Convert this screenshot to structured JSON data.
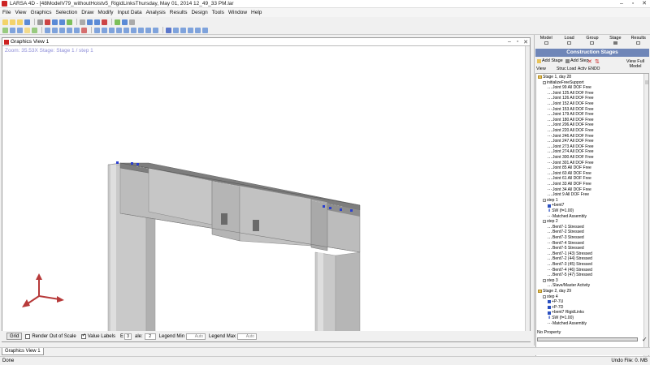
{
  "window": {
    "title": "LARSA 4D - [48ModelV79_withoutHoistv5_RigidLinksThursday, May 01, 2014 12_49_33 PM.lar",
    "minimize": "–",
    "maximize": "▫",
    "close": "✕"
  },
  "menu": [
    "File",
    "View",
    "Graphics",
    "Selection",
    "Draw",
    "Modify",
    "Input Data",
    "Analysis",
    "Results",
    "Design",
    "Tools",
    "Window",
    "Help"
  ],
  "graphics_view": {
    "title": "Graphics View 1",
    "zoom_text": "Zoom: 35.53X    Stage: Stage 1 / step 1",
    "min": "–",
    "restore": "▫",
    "close": "✕"
  },
  "graphics_bar": {
    "grid_button": "Grid",
    "render_out_of_scale": "Render Out of Scale",
    "value_labels": "Value Labels",
    "value_labels_checked": true,
    "scale_label": "E",
    "scale_field": "3",
    "scale_text": "ale:",
    "scale_value": "2",
    "legend_min_label": "Legend Min",
    "legend_min_value": "Auto",
    "legend_max_label": "Legend Max",
    "legend_max_value": "Auto"
  },
  "tab": "Graphics View 1",
  "status": {
    "left": "Done",
    "right": "Undo File: 0. MB"
  },
  "right_panel": {
    "tabs": [
      "Model",
      "Load",
      "Group",
      "Stage",
      "Results"
    ],
    "active_tab": "Stage",
    "header": "Construction Stages",
    "add_stage": "Add Stage",
    "add_step": "Add Step",
    "view": "View",
    "view_full_model": "View Full Model",
    "sub_labels": [
      "Struc",
      "Load",
      "Activ",
      "ENDO"
    ],
    "no_property": "No Property",
    "ok_icon": "✓"
  },
  "tree": [
    {
      "indent": 0,
      "type": "folder",
      "label": "Stage 1, day 28"
    },
    {
      "indent": 1,
      "type": "step",
      "label": "initializeFreeSupport"
    },
    {
      "indent": 2,
      "type": "leaf",
      "label": "Joint 99 All DOF Free"
    },
    {
      "indent": 2,
      "type": "leaf",
      "label": "Joint 125 All DOF Free"
    },
    {
      "indent": 2,
      "type": "leaf",
      "label": "Joint 126 All DOF Free"
    },
    {
      "indent": 2,
      "type": "leaf",
      "label": "Joint 152 All DOF Free"
    },
    {
      "indent": 2,
      "type": "leaf",
      "label": "Joint 153 All DOF Free"
    },
    {
      "indent": 2,
      "type": "leaf",
      "label": "Joint 179 All DOF Free"
    },
    {
      "indent": 2,
      "type": "leaf",
      "label": "Joint 180 All DOF Free"
    },
    {
      "indent": 2,
      "type": "leaf",
      "label": "Joint 206 All DOF Free"
    },
    {
      "indent": 2,
      "type": "leaf",
      "label": "Joint 220 All DOF Free"
    },
    {
      "indent": 2,
      "type": "leaf",
      "label": "Joint 246 All DOF Free"
    },
    {
      "indent": 2,
      "type": "leaf",
      "label": "Joint 247 All DOF Free"
    },
    {
      "indent": 2,
      "type": "leaf",
      "label": "Joint 273 All DOF Free"
    },
    {
      "indent": 2,
      "type": "leaf",
      "label": "Joint 274 All DOF Free"
    },
    {
      "indent": 2,
      "type": "leaf",
      "label": "Joint 300 All DOF Free"
    },
    {
      "indent": 2,
      "type": "leaf",
      "label": "Joint 301 All DOF Free"
    },
    {
      "indent": 2,
      "type": "leaf",
      "label": "Joint 85 All DOF Free"
    },
    {
      "indent": 2,
      "type": "leaf",
      "label": "Joint 60 All DOF Free"
    },
    {
      "indent": 2,
      "type": "leaf",
      "label": "Joint 61 All DOF Free"
    },
    {
      "indent": 2,
      "type": "leaf",
      "label": "Joint 33 All DOF Free"
    },
    {
      "indent": 2,
      "type": "leaf",
      "label": "Joint 34 All DOF Free"
    },
    {
      "indent": 2,
      "type": "leaf",
      "label": "Joint 9 All DOF Free"
    },
    {
      "indent": 1,
      "type": "step",
      "label": "step 1"
    },
    {
      "indent": 2,
      "type": "blue",
      "label": "+bent7"
    },
    {
      "indent": 2,
      "type": "down",
      "label": "SW (f=1.00)"
    },
    {
      "indent": 2,
      "type": "leaf",
      "label": "Matched Assembly"
    },
    {
      "indent": 1,
      "type": "step",
      "label": "step 2"
    },
    {
      "indent": 2,
      "type": "leaf",
      "label": "Bent7-1 Stressed"
    },
    {
      "indent": 2,
      "type": "leaf",
      "label": "Bent7-2 Stressed"
    },
    {
      "indent": 2,
      "type": "leaf",
      "label": "Bent7-3 Stressed"
    },
    {
      "indent": 2,
      "type": "leaf",
      "label": "Bent7-4 Stressed"
    },
    {
      "indent": 2,
      "type": "leaf",
      "label": "Bent7-5 Stressed"
    },
    {
      "indent": 2,
      "type": "leaf",
      "label": "Bent7-1 (43) Stressed"
    },
    {
      "indent": 2,
      "type": "leaf",
      "label": "Bent7-2 (44) Stressed"
    },
    {
      "indent": 2,
      "type": "leaf",
      "label": "Bent7-3 (45) Stressed"
    },
    {
      "indent": 2,
      "type": "leaf",
      "label": "Bent7-4 (46) Stressed"
    },
    {
      "indent": 2,
      "type": "leaf",
      "label": "Bent7-5 (47) Stressed"
    },
    {
      "indent": 1,
      "type": "step",
      "label": "step 3"
    },
    {
      "indent": 2,
      "type": "leaf",
      "label": "Slave/Master Activity"
    },
    {
      "indent": 0,
      "type": "folder",
      "label": "Stage 2, day 29"
    },
    {
      "indent": 1,
      "type": "step",
      "label": "step 4"
    },
    {
      "indent": 2,
      "type": "blue",
      "label": "+P-7U"
    },
    {
      "indent": 2,
      "type": "blue",
      "label": "+P-7D"
    },
    {
      "indent": 2,
      "type": "blue",
      "label": "+bent7 RigidLinks"
    },
    {
      "indent": 2,
      "type": "down",
      "label": "SW (f=1.00)"
    },
    {
      "indent": 2,
      "type": "leaf",
      "label": "Matched Assembly"
    }
  ]
}
